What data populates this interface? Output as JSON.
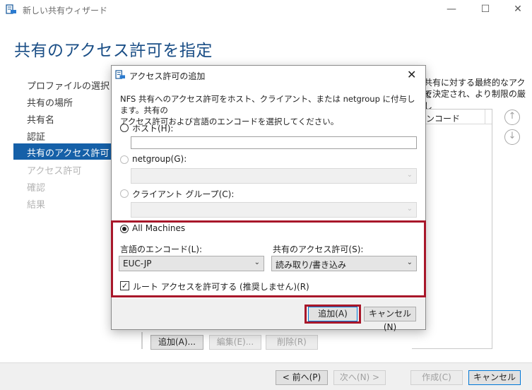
{
  "window": {
    "title": "新しい共有ウィザード",
    "minimize": "—",
    "maximize": "☐",
    "close": "✕"
  },
  "page_title": "共有のアクセス許可を指定",
  "nav": [
    {
      "label": "プロファイルの選択",
      "state": "normal"
    },
    {
      "label": "共有の場所",
      "state": "normal"
    },
    {
      "label": "共有名",
      "state": "normal"
    },
    {
      "label": "認証",
      "state": "normal"
    },
    {
      "label": "共有のアクセス許可",
      "state": "active"
    },
    {
      "label": "アクセス許可",
      "state": "disabled"
    },
    {
      "label": "確認",
      "state": "disabled"
    },
    {
      "label": "結果",
      "state": "disabled"
    }
  ],
  "background": {
    "desc_line1": "共有に対する最終的なアクセ",
    "desc_line2": "て決定され、より制限の厳し",
    "column_header": "ンコード",
    "up_icon": "↑",
    "down_icon": "↓",
    "add_btn": "追加(A)...",
    "edit_btn": "編集(E)...",
    "delete_btn": "削除(R)"
  },
  "footer": {
    "prev": "< 前へ(P)",
    "next": "次へ(N) >",
    "create": "作成(C)",
    "cancel": "キャンセル"
  },
  "dialog": {
    "title": "アクセス許可の追加",
    "close": "✕",
    "description_line1": "NFS 共有へのアクセス許可をホスト、クライアント、または netgroup に付与します。共有の",
    "description_line2": "アクセス許可および言語のエンコードを選択してください。",
    "host_label": "ホスト(H):",
    "host_value": "",
    "netgroup_label": "netgroup(G):",
    "client_group_label": "クライアント グループ(C):",
    "all_machines_label": "All Machines",
    "selected_option": "All Machines",
    "encoding_label": "言語のエンコード(L):",
    "encoding_value": "EUC-JP",
    "permission_label": "共有のアクセス許可(S):",
    "permission_value": "読み取り/書き込み",
    "root_access_label": "ルート アクセスを許可する (推奨しません)(R)",
    "root_access_checked": true,
    "check_mark": "✓",
    "chevron": "⌄",
    "add_button": "追加(A)",
    "cancel_button": "キャンセル(N)"
  },
  "colors": {
    "accent": "#1560a8",
    "title_blue": "#1a4e86",
    "highlight_red": "#a8172a"
  }
}
